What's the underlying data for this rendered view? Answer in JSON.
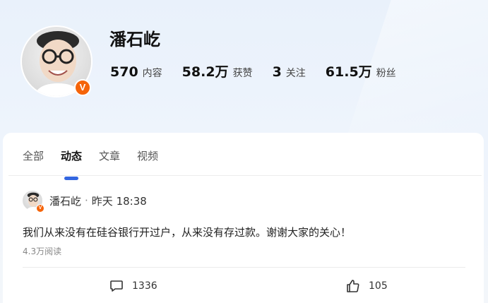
{
  "profile": {
    "name": "潘石屹",
    "verified_badge": "V",
    "stats": [
      {
        "value": "570",
        "label": "内容"
      },
      {
        "value": "58.2万",
        "label": "获赞"
      },
      {
        "value": "3",
        "label": "关注"
      },
      {
        "value": "61.5万",
        "label": "粉丝"
      }
    ]
  },
  "tabs": [
    {
      "label": "全部",
      "active": false
    },
    {
      "label": "动态",
      "active": true
    },
    {
      "label": "文章",
      "active": false
    },
    {
      "label": "视频",
      "active": false
    }
  ],
  "post": {
    "author": "潘石屹",
    "separator": "·",
    "time": "昨天 18:38",
    "text": "我们从来没有在硅谷银行开过户，从来没有存过款。谢谢大家的关心！",
    "reads": "4.3万阅读",
    "comment_count": "1336",
    "like_count": "105",
    "icons": {
      "comment": "comment-icon",
      "like": "thumbs-up-icon"
    }
  },
  "colors": {
    "tab_indicator": "#3366e0",
    "verified_badge": "#f5640a"
  }
}
